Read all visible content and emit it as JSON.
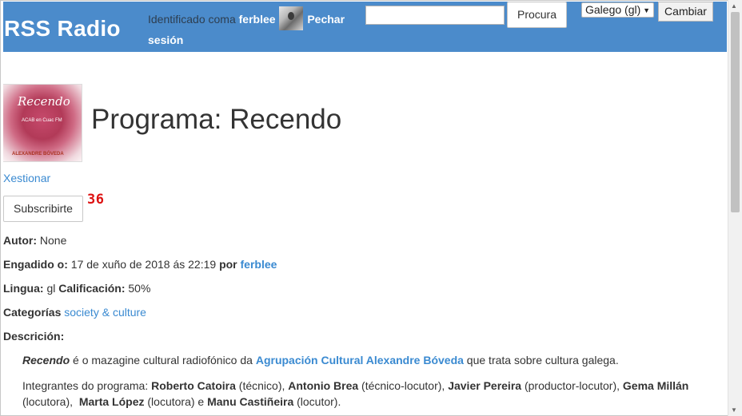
{
  "header": {
    "brand": "RSS Radio",
    "identified_as": "Identificado coma",
    "username": "ferblee",
    "logout": "Pechar sesión",
    "search_placeholder": "",
    "search_button": "Procura",
    "language": "Galego (gl)",
    "change_button": "Cambiar"
  },
  "program": {
    "image_title": "Recendo",
    "image_subtitle": "ACAB en Cuac FM",
    "image_footer": "ALEXANDRE BÓVEDA",
    "title": "Programa: Recendo",
    "manage_link": "Xestionar",
    "subscribe_button": "Subscribirte",
    "subscriber_count": "36"
  },
  "meta": {
    "author_label": "Autor:",
    "author_value": "None",
    "added_label": "Engadido o:",
    "added_value": "17 de xuño de 2018 ás 22:19",
    "by_label": "por",
    "added_by": "ferblee",
    "language_label": "Lingua:",
    "language_value": "gl",
    "rating_label": "Calificación:",
    "rating_value": "50%",
    "categories_label": "Categorías",
    "categories_value": "society & culture",
    "description_label": "Descrición:"
  },
  "description": {
    "p1_name": "Recendo",
    "p1_text1": " é o mazagine cultural radiofónico da ",
    "p1_org": "Agrupación Cultural Alexandre Bóveda",
    "p1_text2": " que trata sobre cultura galega.",
    "p2_intro": "Integrantes do programa: ",
    "m1_name": "Roberto Catoira",
    "m1_role": " (técnico), ",
    "m2_name": "Antonio Brea",
    "m2_role": " (técnico-locutor), ",
    "m3_name": "Javier Pereira",
    "m3_role": " (productor-locutor), ",
    "m4_name": "Gema Millán",
    "m4_role": "(locutora),  ",
    "m5_name": "Marta López",
    "m5_role": " (locutora) e ",
    "m6_name": "Manu Castiñeira",
    "m6_role": " (locutor)."
  },
  "colors": {
    "header_bg": "#4b8bcb",
    "link": "#3a8ad1",
    "count": "#dd1111"
  }
}
